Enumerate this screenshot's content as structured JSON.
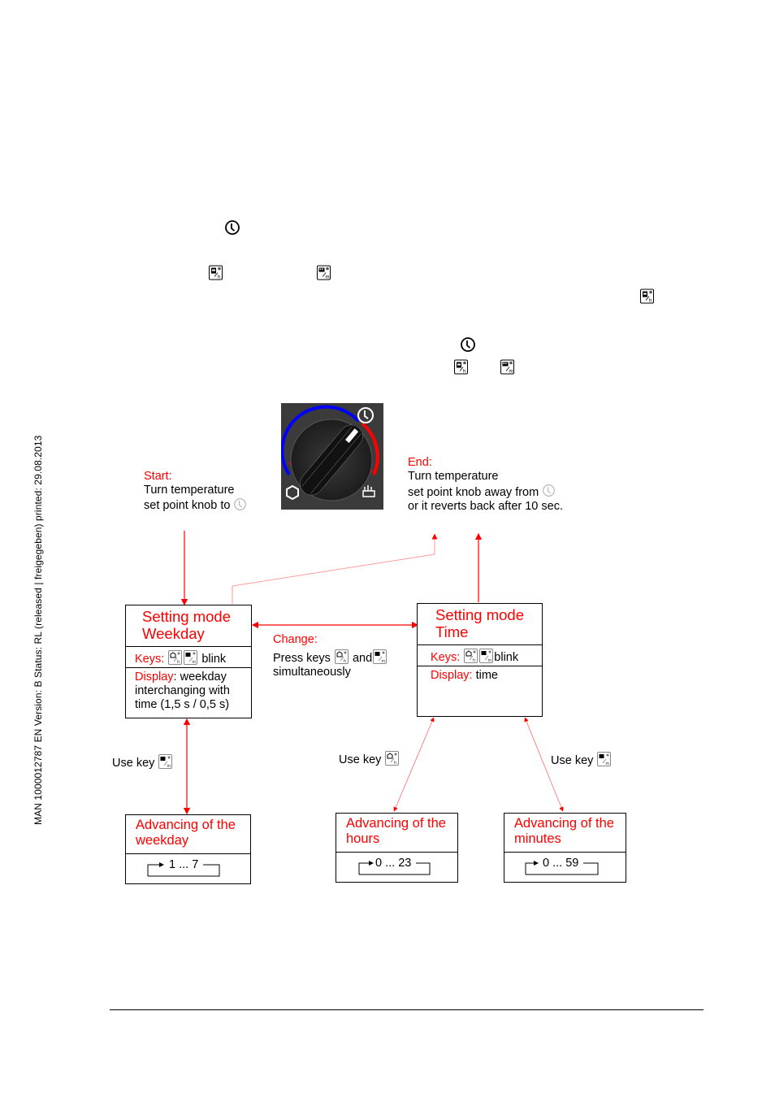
{
  "sidebar_meta": "MAN  1000012787  EN  Version: B  Status: RL (released | freigegeben)  printed: 29.08.2013",
  "icons": {
    "clock": "clock-icon",
    "key_h": "hour-key-icon",
    "key_m": "minute-key-icon",
    "frost": "frost-symbol-icon",
    "comfort": "comfort-symbol-icon"
  },
  "diagram": {
    "start": {
      "label": "Start:",
      "line1": "Turn temperature",
      "line2": "set point knob to"
    },
    "end": {
      "label": "End:",
      "line1": "Turn temperature",
      "line2": "set point knob away from",
      "line3": "or it reverts back after 10 sec."
    },
    "change": {
      "label": "Change:",
      "line1_pre": "Press keys",
      "line1_mid": "and",
      "line2": "simultaneously"
    },
    "weekday_box": {
      "title_line1": "Setting mode",
      "title_line2": "Weekday",
      "keys_label": "Keys:",
      "keys_suffix": "blink",
      "display_label": "Display",
      "display_text1": ": weekday",
      "display_text2": "interchanging with",
      "display_text3": "time (1,5 s / 0,5 s)"
    },
    "time_box": {
      "title_line1": "Setting mode",
      "title_line2": "Time",
      "keys_label": "Keys:",
      "keys_suffix": "blink",
      "display_label": "Display:",
      "display_text": " time"
    },
    "use_key": {
      "left": "Use key",
      "middle": "Use key",
      "right": "Use key"
    },
    "advancing": [
      {
        "line1": "Advancing of the",
        "line2": "weekday",
        "range": "1 ... 7"
      },
      {
        "line1": "Advancing of the",
        "line2": "hours",
        "range": "0 ... 23"
      },
      {
        "line1": "Advancing of the",
        "line2": "minutes",
        "range": "0 ... 59"
      }
    ]
  },
  "colors": {
    "accent": "#ff0000",
    "knob_bg": "#3b3b3b",
    "cold_arc": "#0000ff",
    "warm_arc": "#ff0000"
  }
}
